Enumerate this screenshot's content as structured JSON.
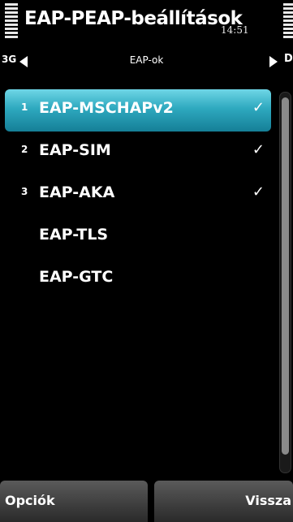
{
  "status": {
    "title": "EAP-PEAP-beállítások",
    "time": "14:51",
    "network": "3G"
  },
  "nav": {
    "title": "EAP-ok",
    "next_clip": "D"
  },
  "list": {
    "items": [
      {
        "num": "1",
        "label": "EAP-MSCHAPv2",
        "check": "✓"
      },
      {
        "num": "2",
        "label": "EAP-SIM",
        "check": "✓"
      },
      {
        "num": "3",
        "label": "EAP-AKA",
        "check": "✓"
      },
      {
        "num": "",
        "label": "EAP-TLS",
        "check": ""
      },
      {
        "num": "",
        "label": "EAP-GTC",
        "check": ""
      }
    ]
  },
  "softkeys": {
    "left": "Opciók",
    "right": "Vissza"
  },
  "colors": {
    "selection": "#2ea9bf",
    "background": "#000000"
  }
}
